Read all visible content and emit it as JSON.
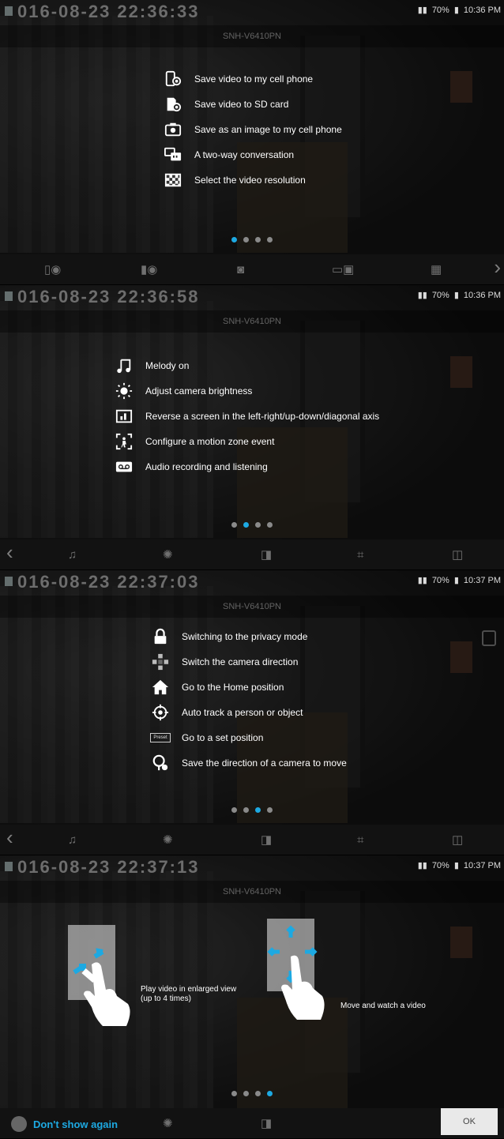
{
  "panels": [
    {
      "timestamp": "016-08-23 22:36:33",
      "status": {
        "battery": "70%",
        "time": "10:36 PM"
      },
      "camera_name": "SNH-V6410PN",
      "items": [
        {
          "icon": "phone-video-icon",
          "label": "Save video to my cell phone"
        },
        {
          "icon": "sd-card-video-icon",
          "label": "Save video to SD card"
        },
        {
          "icon": "camera-icon",
          "label": "Save as an image to my cell phone"
        },
        {
          "icon": "two-way-talk-icon",
          "label": "A two-way conversation"
        },
        {
          "icon": "resolution-icon",
          "label": "Select the video resolution"
        }
      ],
      "active_page": 0
    },
    {
      "timestamp": "016-08-23 22:36:58",
      "status": {
        "battery": "70%",
        "time": "10:36 PM"
      },
      "camera_name": "SNH-V6410PN",
      "items": [
        {
          "icon": "music-note-icon",
          "label": "Melody on"
        },
        {
          "icon": "brightness-icon",
          "label": "Adjust camera brightness"
        },
        {
          "icon": "flip-screen-icon",
          "label": "Reverse a screen in the left-right/up-down/diagonal axis"
        },
        {
          "icon": "motion-zone-icon",
          "label": "Configure a motion zone event"
        },
        {
          "icon": "voicemail-icon",
          "label": "Audio recording and listening"
        }
      ],
      "active_page": 1
    },
    {
      "timestamp": "016-08-23 22:37:03",
      "status": {
        "battery": "70%",
        "time": "10:37 PM"
      },
      "camera_name": "SNH-V6410PN",
      "items": [
        {
          "icon": "lock-icon",
          "label": "Switching to the privacy mode"
        },
        {
          "icon": "direction-pad-icon",
          "label": "Switch the camera direction"
        },
        {
          "icon": "home-icon",
          "label": "Go to the Home position"
        },
        {
          "icon": "target-icon",
          "label": "Auto track a person or object"
        },
        {
          "icon": "preset-icon",
          "label": "Go to a set position",
          "badge": "Preset"
        },
        {
          "icon": "save-direction-icon",
          "label": "Save the direction of a camera to move"
        }
      ],
      "active_page": 2
    },
    {
      "timestamp": "016-08-23 22:37:13",
      "status": {
        "battery": "70%",
        "time": "10:37 PM"
      },
      "camera_name": "SNH-V6410PN",
      "gestures": [
        {
          "label_line1": "Play video in enlarged view",
          "label_line2": "(up to 4 times)"
        },
        {
          "label_line1": "Move and watch a video",
          "label_line2": ""
        }
      ],
      "dont_show_label": "Don't show again",
      "ok_label": "OK",
      "active_page": 3
    }
  ],
  "colors": {
    "accent": "#1da9e2",
    "dot_inactive": "#8a8a8a"
  }
}
